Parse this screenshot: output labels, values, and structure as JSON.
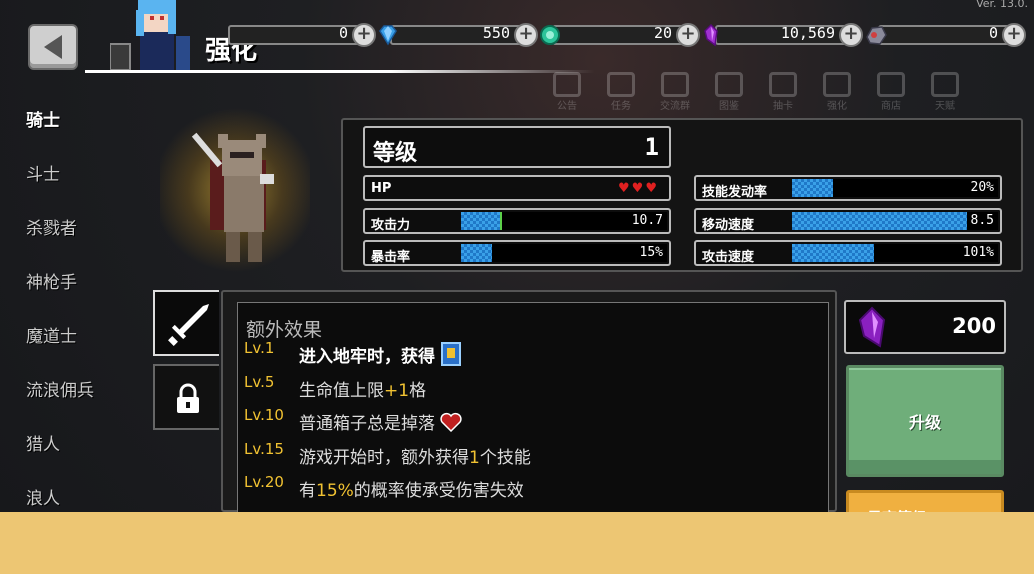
{
  "app": {
    "version": "Ver. 13.0.",
    "page_title": "强化"
  },
  "resources": [
    {
      "icon": "coin-icon",
      "value": "0",
      "color": "#f0c020"
    },
    {
      "icon": "diamond-icon",
      "value": "550",
      "color": "#3aa0e8"
    },
    {
      "icon": "green-gem-icon",
      "value": "20",
      "color": "#2cc49a"
    },
    {
      "icon": "purple-crystal-icon",
      "value": "10,569",
      "color": "#b040e0"
    },
    {
      "icon": "ore-icon",
      "value": "0",
      "color": "#c05050"
    }
  ],
  "class_list": [
    {
      "label": "骑士",
      "active": true
    },
    {
      "label": "斗士",
      "active": false
    },
    {
      "label": "杀戮者",
      "active": false
    },
    {
      "label": "神枪手",
      "active": false
    },
    {
      "label": "魔道士",
      "active": false
    },
    {
      "label": "流浪佣兵",
      "active": false
    },
    {
      "label": "猎人",
      "active": false
    },
    {
      "label": "浪人",
      "active": false
    }
  ],
  "stats": {
    "level_label": "等级",
    "level_value": "1",
    "hp_label": "HP",
    "hp_hearts": 3,
    "attack_label": "攻击力",
    "attack_value": "10.7",
    "attack_fill": 0.2,
    "crit_label": "暴击率",
    "crit_value": "15%",
    "crit_fill": 0.15,
    "skill_rate_label": "技能发动率",
    "skill_rate_value": "20%",
    "skill_rate_fill": 0.2,
    "move_speed_label": "移动速度",
    "move_speed_value": "8.5",
    "move_speed_fill": 0.85,
    "attack_speed_label": "攻击速度",
    "attack_speed_value": "101%",
    "attack_speed_fill": 0.4
  },
  "effects": {
    "heading": "额外效果",
    "rows": [
      {
        "lv": "Lv.1",
        "pre": "进入地牢时，获得",
        "hl": "",
        "post": "",
        "icon": "card-icon",
        "bright": true
      },
      {
        "lv": "Lv.5",
        "pre": "生命值上限",
        "hl": "+1",
        "post": "格",
        "icon": "",
        "bright": false
      },
      {
        "lv": "Lv.10",
        "pre": "普通箱子总是掉落",
        "hl": "",
        "post": "",
        "icon": "heart-icon",
        "bright": false
      },
      {
        "lv": "Lv.15",
        "pre": "游戏开始时，额外获得",
        "hl": "1",
        "post": "个技能",
        "icon": "",
        "bright": false
      },
      {
        "lv": "Lv.20",
        "pre": "有",
        "hl": "15%",
        "post": "的概率使承受伤害失效",
        "icon": "",
        "bright": false
      }
    ]
  },
  "upgrade": {
    "cost_value": "200",
    "cost_icon": "purple-crystal-icon",
    "upgrade_label": "升级",
    "max_label": "最高等级"
  },
  "menu_icons": [
    "公告",
    "任务",
    "交流群",
    "图鉴",
    "抽卡",
    "强化",
    "商店",
    "天赋"
  ]
}
